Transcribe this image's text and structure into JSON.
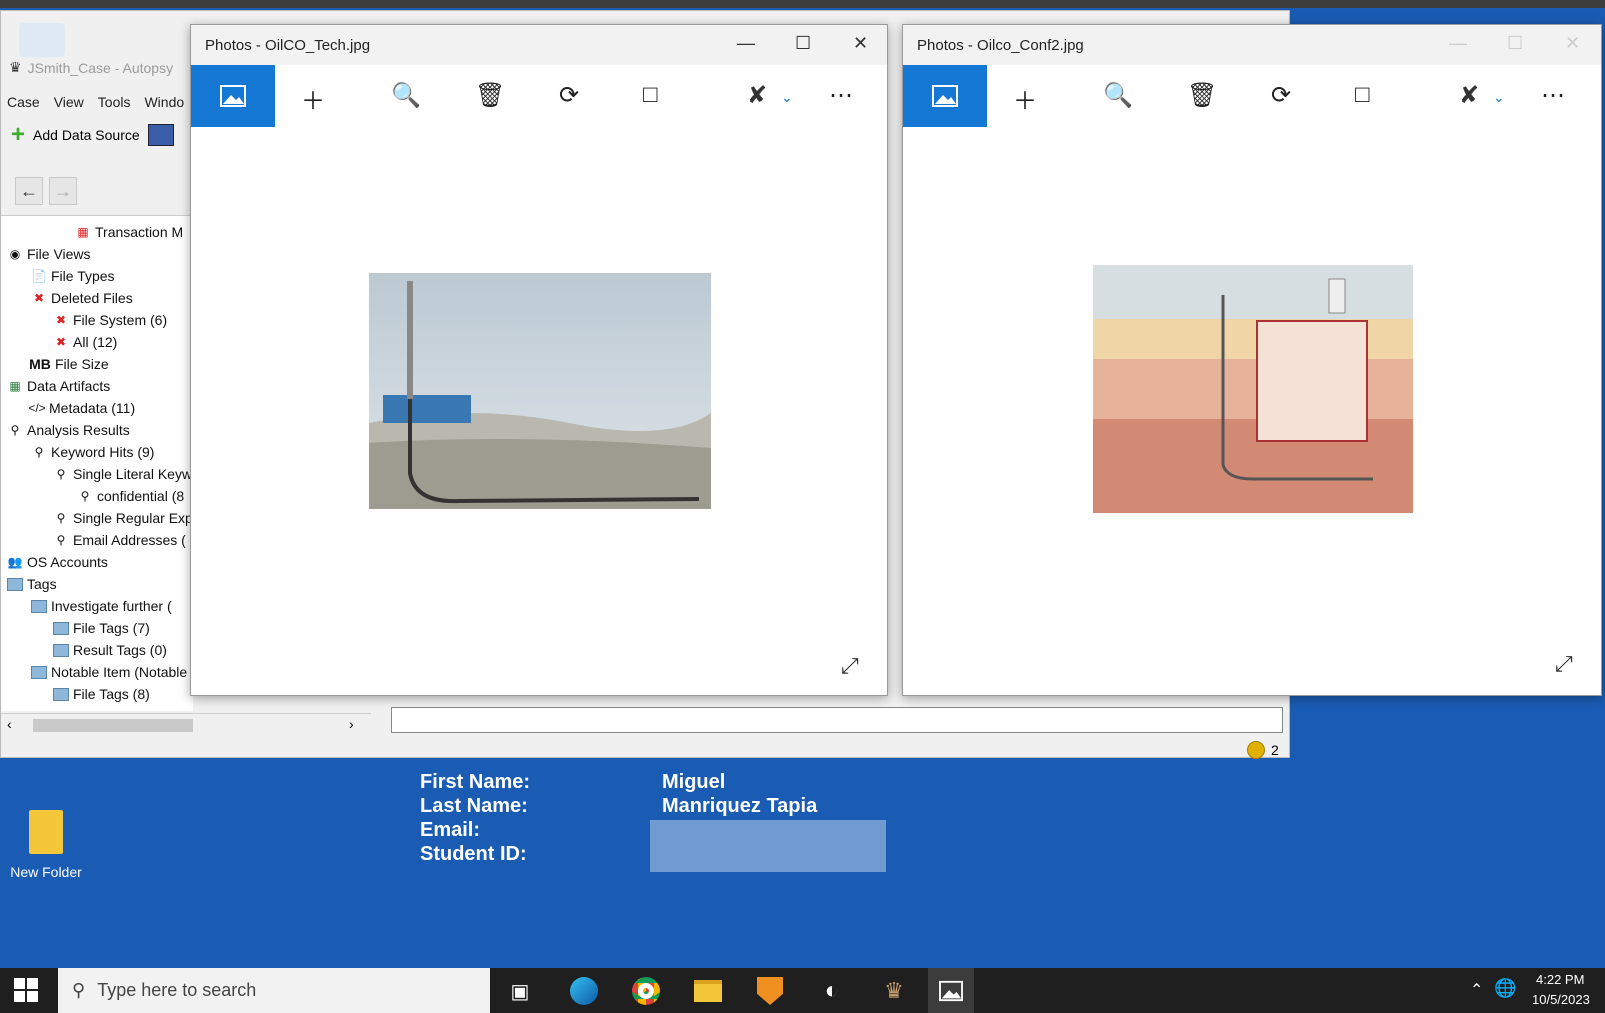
{
  "autopsy": {
    "title": "JSmith_Case - Autopsy",
    "menu": [
      "Case",
      "View",
      "Tools",
      "Windo"
    ],
    "add_data_source": "Add Data Source",
    "tree": [
      {
        "label": "Transaction M",
        "icon": "pdf-icon"
      },
      {
        "label": "File Views",
        "icon": "eye-icon"
      },
      {
        "label": "File Types",
        "icon": "file-types-icon"
      },
      {
        "label": "Deleted Files",
        "icon": "deleted-icon"
      },
      {
        "label": "File System (6)",
        "icon": "deleted-file-icon"
      },
      {
        "label": "All (12)",
        "icon": "deleted-file-icon"
      },
      {
        "label": "File Size",
        "icon": "mb-icon"
      },
      {
        "label": "Data Artifacts",
        "icon": "artifacts-icon"
      },
      {
        "label": "Metadata (11)",
        "icon": "code-icon"
      },
      {
        "label": "Analysis Results",
        "icon": "magnifier-icon"
      },
      {
        "label": "Keyword Hits (9)",
        "icon": "magnifier-icon"
      },
      {
        "label": "Single Literal Keyw",
        "icon": "magnifier-icon"
      },
      {
        "label": "confidential (8",
        "icon": "magnifier-icon"
      },
      {
        "label": "Single Regular Exp",
        "icon": "magnifier-icon"
      },
      {
        "label": "Email Addresses (",
        "icon": "magnifier-icon"
      },
      {
        "label": "OS Accounts",
        "icon": "accounts-icon"
      },
      {
        "label": "Tags",
        "icon": "tag-folder-icon"
      },
      {
        "label": "Investigate further (",
        "icon": "tag-folder-icon"
      },
      {
        "label": "File Tags (7)",
        "icon": "tag-folder-icon"
      },
      {
        "label": "Result Tags (0)",
        "icon": "tag-folder-icon"
      },
      {
        "label": "Notable Item (Notable",
        "icon": "tag-folder-icon"
      },
      {
        "label": "File Tags (8)",
        "icon": "tag-folder-icon"
      }
    ],
    "mb_prefix": "MB",
    "notifications": "2"
  },
  "photos1": {
    "title": "Photos - OilCO_Tech.jpg"
  },
  "photos2": {
    "title": "Photos - Oilco_Conf2.jpg"
  },
  "desktop": {
    "folder_label": "New Folder",
    "labels": {
      "first": "First Name:",
      "last": "Last Name:",
      "email": "Email:",
      "student": "Student ID:"
    },
    "values": {
      "first": "Miguel",
      "last": "Manriquez Tapia"
    }
  },
  "taskbar": {
    "search_placeholder": "Type here to search",
    "time": "4:22 PM",
    "date": "10/5/2023"
  }
}
